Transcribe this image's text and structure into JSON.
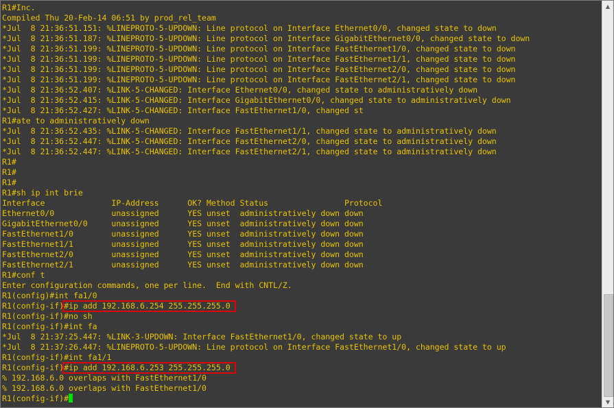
{
  "terminal": {
    "lines": [
      "R1#Inc.",
      "Compiled Thu 20-Feb-14 06:51 by prod_rel_team",
      "*Jul  8 21:36:51.151: %LINEPROTO-5-UPDOWN: Line protocol on Interface Ethernet0/0, changed state to down",
      "*Jul  8 21:36:51.187: %LINEPROTO-5-UPDOWN: Line protocol on Interface GigabitEthernet0/0, changed state to down",
      "*Jul  8 21:36:51.199: %LINEPROTO-5-UPDOWN: Line protocol on Interface FastEthernet1/0, changed state to down",
      "*Jul  8 21:36:51.199: %LINEPROTO-5-UPDOWN: Line protocol on Interface FastEthernet1/1, changed state to down",
      "*Jul  8 21:36:51.199: %LINEPROTO-5-UPDOWN: Line protocol on Interface FastEthernet2/0, changed state to down",
      "*Jul  8 21:36:51.199: %LINEPROTO-5-UPDOWN: Line protocol on Interface FastEthernet2/1, changed state to down",
      "*Jul  8 21:36:52.407: %LINK-5-CHANGED: Interface Ethernet0/0, changed state to administratively down",
      "*Jul  8 21:36:52.415: %LINK-5-CHANGED: Interface GigabitEthernet0/0, changed state to administratively down",
      "*Jul  8 21:36:52.427: %LINK-5-CHANGED: Interface FastEthernet1/0, changed st",
      "R1#ate to administratively down",
      "*Jul  8 21:36:52.435: %LINK-5-CHANGED: Interface FastEthernet1/1, changed state to administratively down",
      "*Jul  8 21:36:52.447: %LINK-5-CHANGED: Interface FastEthernet2/0, changed state to administratively down",
      "*Jul  8 21:36:52.447: %LINK-5-CHANGED: Interface FastEthernet2/1, changed state to administratively down",
      "R1#",
      "R1#",
      "R1#",
      "R1#sh ip int brie",
      "Interface              IP-Address      OK? Method Status                Protocol",
      "Ethernet0/0            unassigned      YES unset  administratively down down",
      "GigabitEthernet0/0     unassigned      YES unset  administratively down down",
      "FastEthernet1/0        unassigned      YES unset  administratively down down",
      "FastEthernet1/1        unassigned      YES unset  administratively down down",
      "FastEthernet2/0        unassigned      YES unset  administratively down down",
      "FastEthernet2/1        unassigned      YES unset  administratively down down",
      "R1#conf t",
      "Enter configuration commands, one per line.  End with CNTL/Z.",
      "R1(config)#int fa1/0",
      {
        "prompt": "R1(config-if)",
        "command": "#ip add 192.168.6.254 255.255.255.0",
        "highlight": true
      },
      "R1(config-if)#no sh",
      "R1(config-if)#int fa",
      "*Jul  8 21:37:25.447: %LINK-3-UPDOWN: Interface FastEthernet1/0, changed state to up",
      "*Jul  8 21:37:26.447: %LINEPROTO-5-UPDOWN: Line protocol on Interface FastEthernet1/0, changed state to up",
      "R1(config-if)#int fa1/1",
      {
        "prompt": "R1(config-if)",
        "command": "#ip add 192.168.6.253 255.255.255.0",
        "highlight": true
      },
      "% 192.168.6.0 overlaps with FastEthernet1/0",
      "% 192.168.6.0 overlaps with FastEthernet1/0",
      {
        "prompt": "R1(config-if)#",
        "command": "",
        "cursor": true
      }
    ]
  },
  "colors": {
    "background": "#3a3a3a",
    "text": "#e8c200",
    "highlight_border": "#e00000",
    "cursor": "#00e000"
  },
  "icons": {
    "scroll_up": "triangle-up",
    "scroll_down": "triangle-down"
  }
}
